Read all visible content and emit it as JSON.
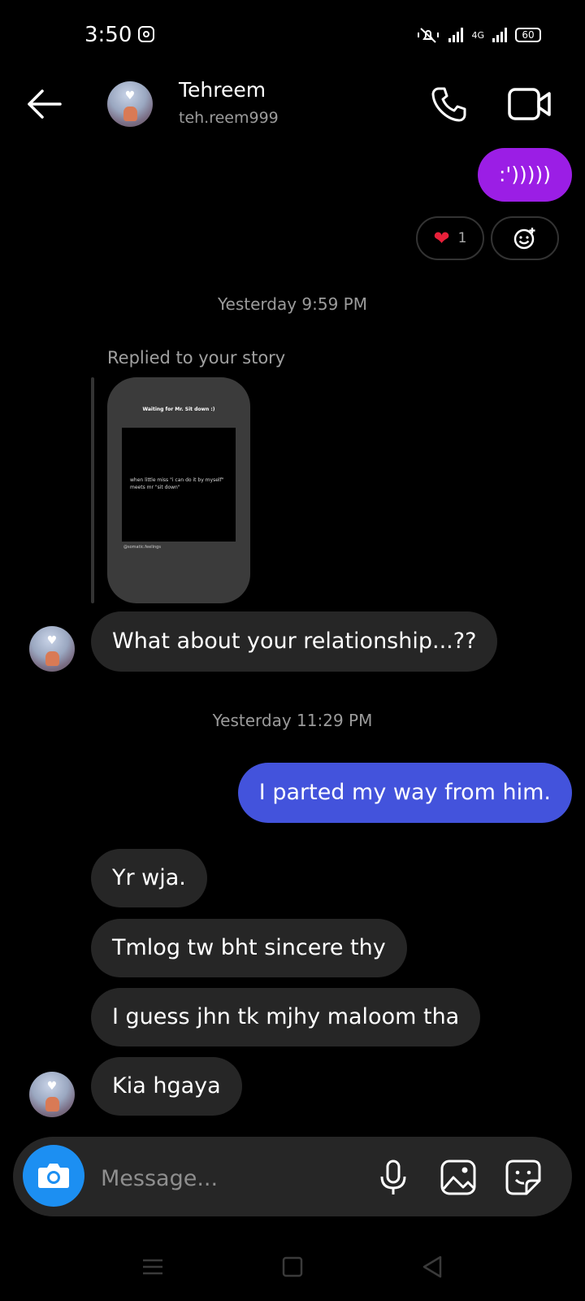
{
  "status_bar": {
    "time": "3:50",
    "network_label": "4G",
    "battery": "60"
  },
  "header": {
    "name": "Tehreem",
    "username": "teh.reem999"
  },
  "reactions": {
    "heart_count": "1"
  },
  "messages": [
    {
      "id": "m1",
      "direction": "outgoing",
      "text": ":')))))",
      "color": "#9b1ee5"
    },
    {
      "id": "ts1",
      "type": "timestamp",
      "text": "Yesterday 9:59 PM"
    },
    {
      "id": "story_reply",
      "type": "story_reply",
      "label": "Replied to your story",
      "story": {
        "title": "Waiting for Mr. Sit down :)",
        "body": "when little miss \"i can do it by myself\" meets mr \"sit down\"",
        "footer": "@somatic.feelings"
      }
    },
    {
      "id": "m2",
      "direction": "incoming",
      "text": "What about your relationship...??"
    },
    {
      "id": "ts2",
      "type": "timestamp",
      "text": "Yesterday 11:29 PM"
    },
    {
      "id": "m3",
      "direction": "outgoing",
      "text": "I parted my way from him.",
      "color": "#4353dc"
    },
    {
      "id": "m4",
      "direction": "incoming",
      "text": "Yr wja."
    },
    {
      "id": "m5",
      "direction": "incoming",
      "text": "Tmlog tw bht sincere thy"
    },
    {
      "id": "m6",
      "direction": "incoming",
      "text": "I guess jhn tk mjhy maloom tha"
    },
    {
      "id": "m7",
      "direction": "incoming",
      "text": "Kia hgaya"
    }
  ],
  "composer": {
    "placeholder": "Message..."
  },
  "colors": {
    "background": "#000000",
    "incoming_bubble": "#262626",
    "camera_button": "#1c8ff2"
  }
}
